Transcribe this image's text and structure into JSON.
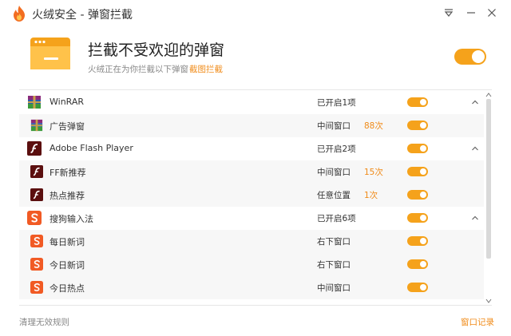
{
  "window": {
    "title": "火绒安全 - 弹窗拦截",
    "colors": {
      "accent": "#f5a21b",
      "link": "#f08b19"
    },
    "icons": [
      "huorong-logo-icon",
      "menu-dropdown-icon",
      "minimize-icon",
      "close-icon"
    ]
  },
  "header": {
    "title": "拦截不受欢迎的弹窗",
    "subtitle": "火绒正在为你拦截以下弹窗",
    "screenshot_link": "截图拦截",
    "master_switch_on": true
  },
  "rows": [
    {
      "type": "group",
      "icon": "winrar-icon",
      "name": "WinRAR",
      "status": "已开启1项",
      "count": "",
      "on": true,
      "expanded": true
    },
    {
      "type": "child",
      "icon": "winrar-icon",
      "name": "广告弹窗",
      "status": "中间窗口",
      "count": "88次",
      "on": true
    },
    {
      "type": "group",
      "icon": "flash-icon",
      "name": "Adobe Flash Player",
      "status": "已开启2项",
      "count": "",
      "on": true,
      "expanded": true
    },
    {
      "type": "child",
      "icon": "flash-icon",
      "name": "FF新推荐",
      "status": "中间窗口",
      "count": "15次",
      "on": true
    },
    {
      "type": "child",
      "icon": "flash-icon",
      "name": "热点推荐",
      "status": "任意位置",
      "count": "1次",
      "on": true
    },
    {
      "type": "group",
      "icon": "sogou-icon",
      "name": "搜狗输入法",
      "status": "已开启6项",
      "count": "",
      "on": true,
      "expanded": true
    },
    {
      "type": "child",
      "icon": "sogou-icon",
      "name": "每日新词",
      "status": "右下窗口",
      "count": "",
      "on": true
    },
    {
      "type": "child",
      "icon": "sogou-icon",
      "name": "今日新词",
      "status": "右下窗口",
      "count": "",
      "on": true
    },
    {
      "type": "child",
      "icon": "sogou-icon",
      "name": "今日热点",
      "status": "中间窗口",
      "count": "",
      "on": true
    }
  ],
  "footer": {
    "clean_label": "清理无效规则",
    "records_label": "窗口记录"
  }
}
